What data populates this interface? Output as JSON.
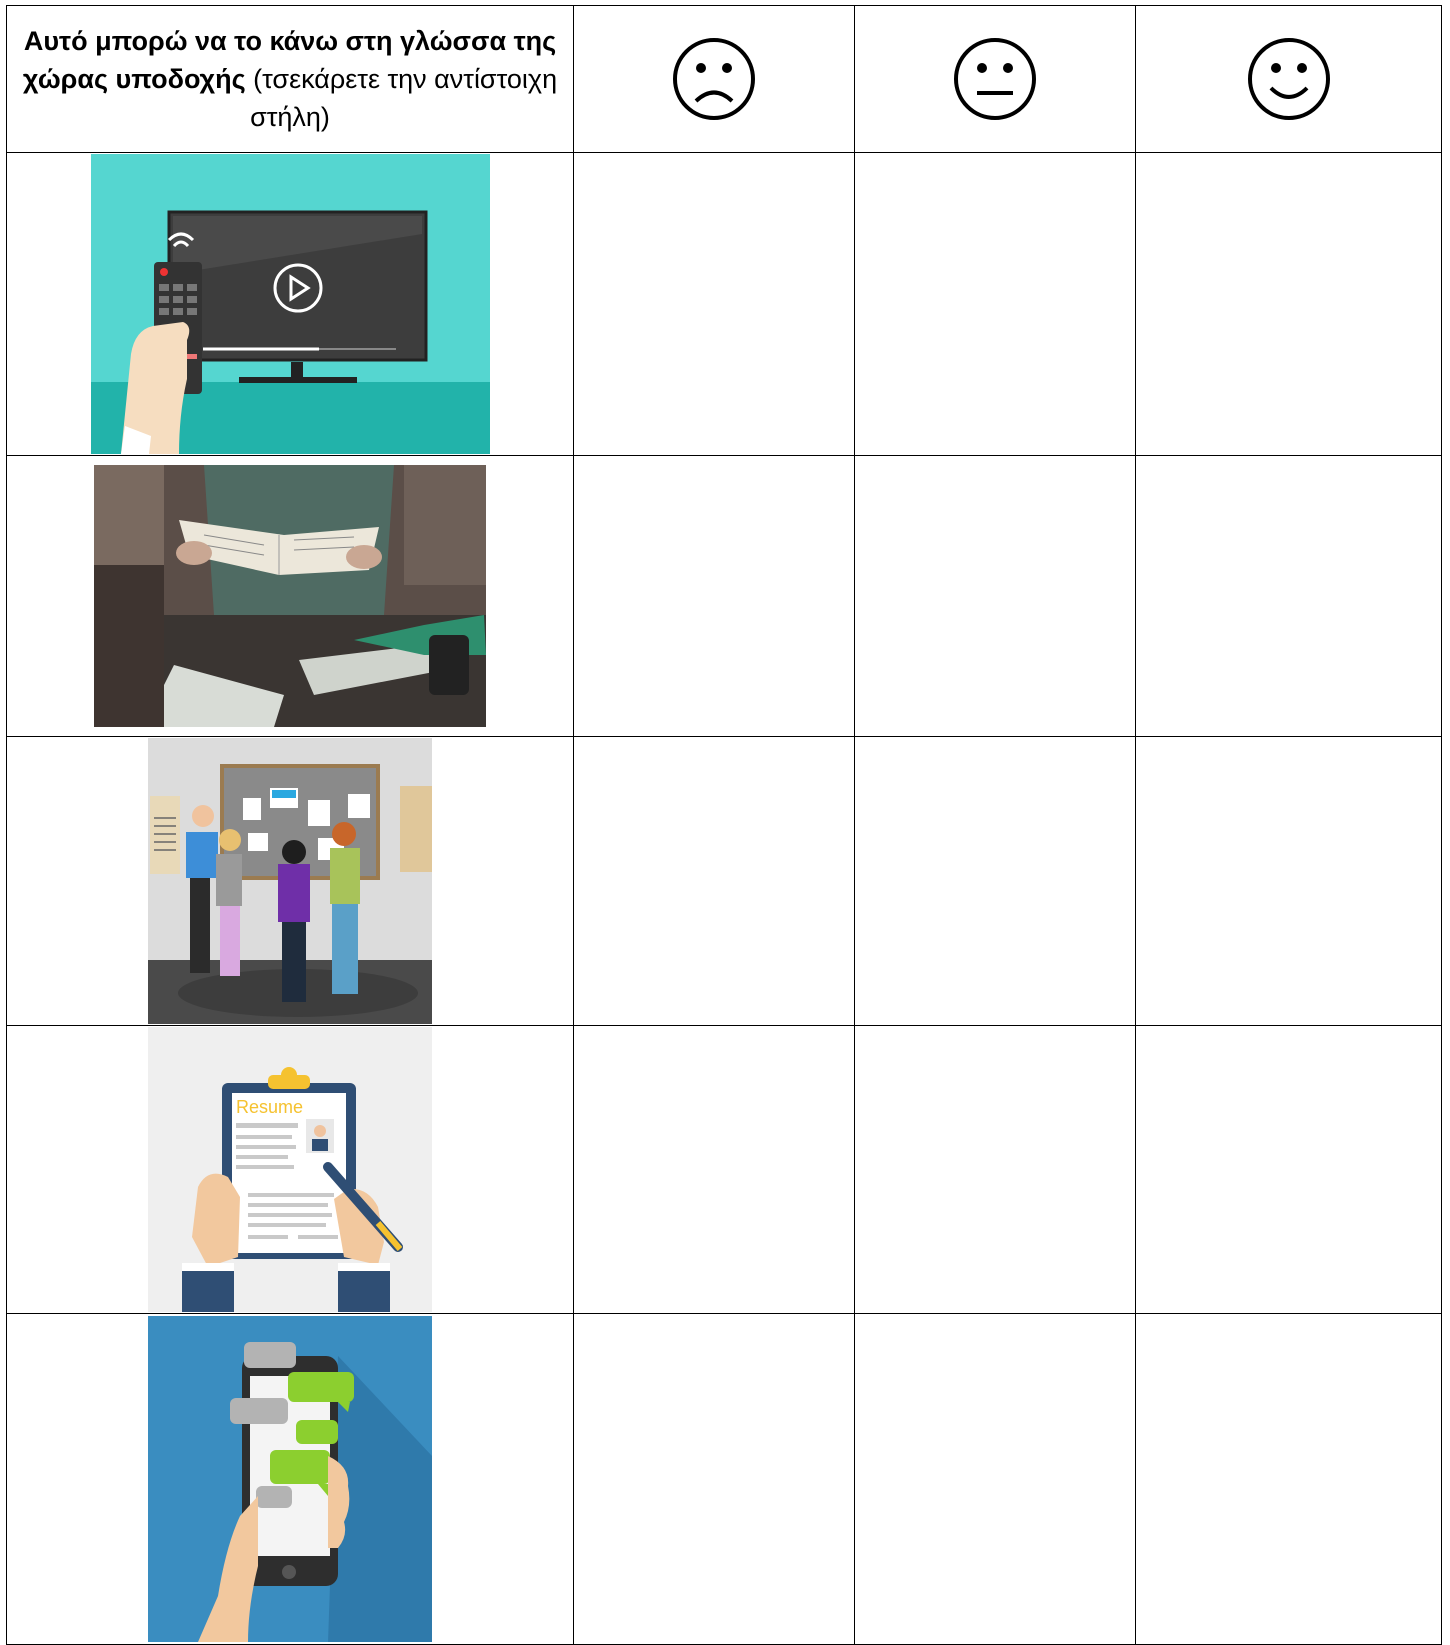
{
  "header": {
    "bold_text": "Αυτό μπορώ να το κάνω στη γλώσσα της χώρας υποδοχής",
    "normal_text": " (τσεκάρετε την αντίστοιχη στήλη)",
    "columns": [
      {
        "icon": "sad-face-icon"
      },
      {
        "icon": "neutral-face-icon"
      },
      {
        "icon": "happy-face-icon"
      }
    ]
  },
  "rows": [
    {
      "image": "tv-remote-illustration"
    },
    {
      "image": "reading-assembly-instructions-photo"
    },
    {
      "image": "notice-board-people-illustration"
    },
    {
      "image": "resume-clipboard-illustration"
    },
    {
      "image": "smartphone-chat-illustration"
    }
  ],
  "colors": {
    "tv_bg": "#55d6d0",
    "tv_floor": "#22b3aa",
    "phone_bg": "#3a8dc0",
    "chat_green": "#8ccf2f",
    "chat_gray": "#b3b3b3",
    "resume_accent": "#f5c230"
  }
}
